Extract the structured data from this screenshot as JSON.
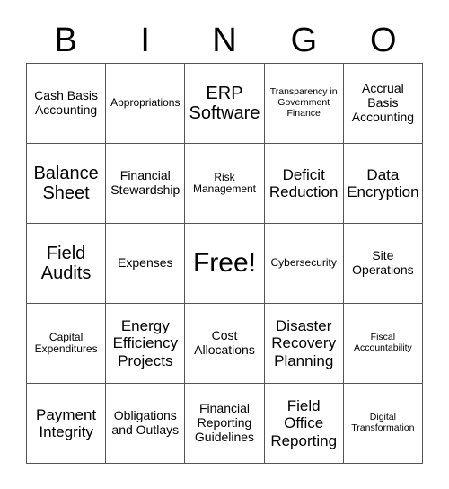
{
  "card": {
    "title": "BINGO",
    "header_letters": [
      "B",
      "I",
      "N",
      "G",
      "O"
    ],
    "free_space_label": "Free!",
    "colors": {
      "background": "#ffffff",
      "grid_line": "#555555",
      "text": "#000000"
    },
    "grid": {
      "columns": 5,
      "rows": 5
    },
    "cells": [
      [
        {
          "label": "Cash Basis Accounting",
          "size": "md"
        },
        {
          "label": "Appropriations",
          "size": "sm"
        },
        {
          "label": "ERP Software",
          "size": "xl"
        },
        {
          "label": "Transparency in Government Finance",
          "size": "xs"
        },
        {
          "label": "Accrual Basis Accounting",
          "size": "md"
        }
      ],
      [
        {
          "label": "Balance Sheet",
          "size": "xl"
        },
        {
          "label": "Financial Stewardship",
          "size": "md"
        },
        {
          "label": "Risk Management",
          "size": "sm"
        },
        {
          "label": "Deficit Reduction",
          "size": "lg"
        },
        {
          "label": "Data Encryption",
          "size": "lg"
        }
      ],
      [
        {
          "label": "Field Audits",
          "size": "xl"
        },
        {
          "label": "Expenses",
          "size": "md"
        },
        {
          "label": "Free!",
          "size": "free"
        },
        {
          "label": "Cybersecurity",
          "size": "sm"
        },
        {
          "label": "Site Operations",
          "size": "md"
        }
      ],
      [
        {
          "label": "Capital Expenditures",
          "size": "sm"
        },
        {
          "label": "Energy Efficiency Projects",
          "size": "lg"
        },
        {
          "label": "Cost Allocations",
          "size": "md"
        },
        {
          "label": "Disaster Recovery Planning",
          "size": "lg"
        },
        {
          "label": "Fiscal Accountability",
          "size": "xs"
        }
      ],
      [
        {
          "label": "Payment Integrity",
          "size": "lg"
        },
        {
          "label": "Obligations and Outlays",
          "size": "md"
        },
        {
          "label": "Financial Reporting Guidelines",
          "size": "md"
        },
        {
          "label": "Field Office Reporting",
          "size": "lg"
        },
        {
          "label": "Digital Transformation",
          "size": "xs"
        }
      ]
    ]
  }
}
